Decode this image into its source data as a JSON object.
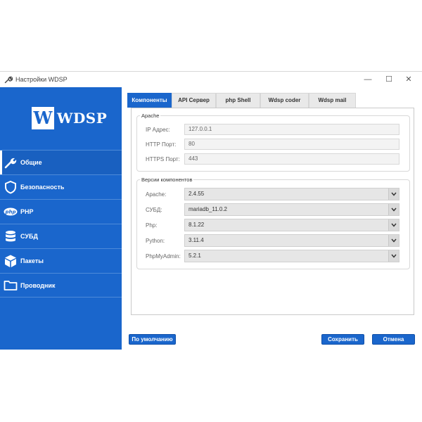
{
  "window": {
    "title": "Настройки WDSP",
    "icon": "wrench-icon",
    "controls": [
      "minimize-icon",
      "maximize-icon",
      "close-icon"
    ]
  },
  "sidebar": {
    "logo": {
      "letter": "W",
      "text": "WDSP"
    },
    "items": [
      {
        "label": "Общие",
        "icon": "wrench-icon",
        "active": true
      },
      {
        "label": "Безопасность",
        "icon": "shield-icon",
        "active": false
      },
      {
        "label": "PHP",
        "icon": "php-icon",
        "active": false
      },
      {
        "label": "СУБД",
        "icon": "database-icon",
        "active": false
      },
      {
        "label": "Пакеты",
        "icon": "package-icon",
        "active": false
      },
      {
        "label": "Проводник",
        "icon": "folder-icon",
        "active": false
      }
    ]
  },
  "tabs": [
    {
      "label": "Компоненты",
      "active": true
    },
    {
      "label": "API Сервер",
      "active": false
    },
    {
      "label": "php Shell",
      "active": false
    },
    {
      "label": "Wdsp coder",
      "active": false
    },
    {
      "label": "Wdsp mail",
      "active": false
    }
  ],
  "apache": {
    "legend": "Apache",
    "fields": [
      {
        "label": "IP Адрес:",
        "value": "127.0.0.1"
      },
      {
        "label": "HTTP Порт:",
        "value": "80"
      },
      {
        "label": "HTTPS Порт:",
        "value": "443"
      }
    ]
  },
  "versions": {
    "legend": "Версии компонентов",
    "selects": [
      {
        "label": "Apache:",
        "value": "2.4.55"
      },
      {
        "label": "СУБД:",
        "value": "mariadb_11.0.2"
      },
      {
        "label": "Php:",
        "value": "8.1.22"
      },
      {
        "label": "Python:",
        "value": "3.11.4"
      },
      {
        "label": "PhpMyAdmin:",
        "value": "5.2.1"
      }
    ]
  },
  "buttons": {
    "default": "По умолчанию",
    "save": "Сохранить",
    "cancel": "Отмена"
  },
  "colors": {
    "accent": "#1a66cc",
    "sidebar": "#1a66cc",
    "tab_inactive": "#e9e9e9"
  }
}
